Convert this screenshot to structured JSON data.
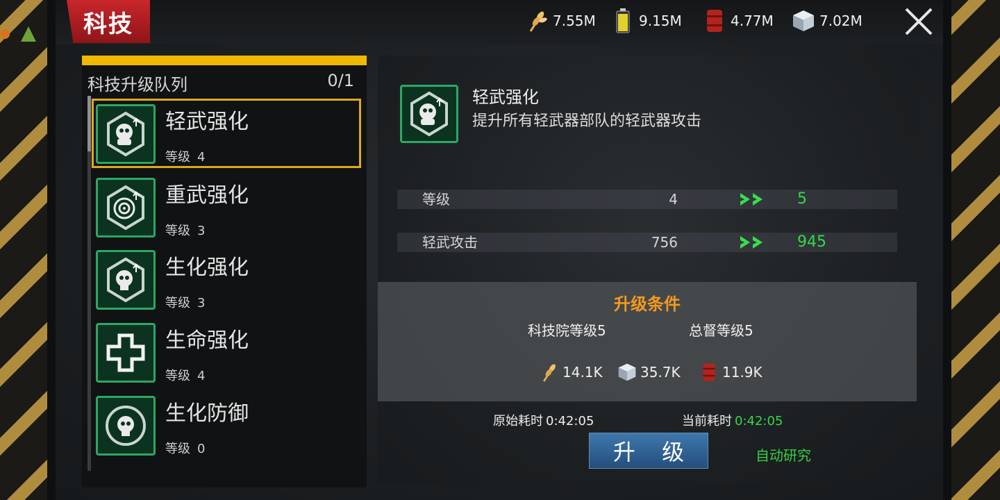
{
  "window": {
    "title": "科技"
  },
  "resources": [
    {
      "icon": "wheat-icon",
      "value": "7.55M"
    },
    {
      "icon": "battery-icon",
      "value": "9.15M"
    },
    {
      "icon": "oil-barrel-icon",
      "value": "4.77M"
    },
    {
      "icon": "steel-cube-icon",
      "value": "7.02M"
    }
  ],
  "queue": {
    "title": "科技升级队列",
    "count": "0/1"
  },
  "tech_list": [
    {
      "name": "轻武强化",
      "level_label": "等级",
      "level": "4",
      "icon": "skull-gasmask-upgrade-icon",
      "selected": true
    },
    {
      "name": "重武强化",
      "level_label": "等级",
      "level": "3",
      "icon": "target-upgrade-icon",
      "selected": false
    },
    {
      "name": "生化强化",
      "level_label": "等级",
      "level": "3",
      "icon": "skull-upgrade-icon",
      "selected": false
    },
    {
      "name": "生命强化",
      "level_label": "等级",
      "level": "4",
      "icon": "medical-cross-icon",
      "selected": false
    },
    {
      "name": "生化防御",
      "level_label": "等级",
      "level": "0",
      "icon": "skull-shield-icon",
      "selected": false
    }
  ],
  "detail": {
    "name": "轻武强化",
    "description": "提升所有轻武器部队的轻武器攻击",
    "stats": [
      {
        "label": "等级",
        "current": "4",
        "next": "5"
      },
      {
        "label": "轻武攻击",
        "current": "756",
        "next": "945"
      }
    ]
  },
  "conditions": {
    "title": "升级条件",
    "requirements": [
      "科技院等级5",
      "总督等级5"
    ],
    "costs": [
      {
        "icon": "wheat-icon",
        "value": "14.1K"
      },
      {
        "icon": "steel-cube-icon",
        "value": "35.7K"
      },
      {
        "icon": "oil-barrel-icon",
        "value": "11.9K"
      }
    ]
  },
  "time": {
    "original_label": "原始耗时",
    "original_value": "0:42:05",
    "current_label": "当前耗时",
    "current_value": "0:42:05"
  },
  "actions": {
    "upgrade": "升 级",
    "auto_research": "自动研究"
  },
  "colors": {
    "accent_yellow": "#f0b800",
    "title_red": "#c8262b",
    "icon_green": "#2ba865",
    "value_green": "#34d84a",
    "condition_orange": "#f49a1e",
    "button_blue": "#2f6496"
  }
}
